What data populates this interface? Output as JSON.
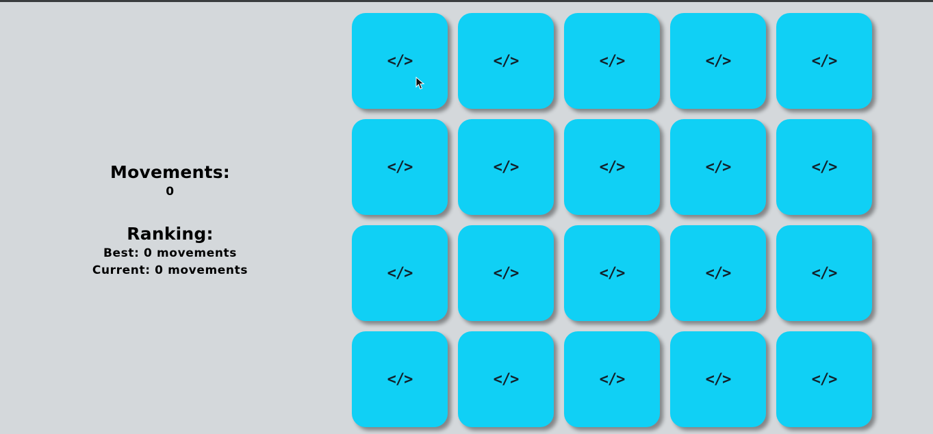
{
  "theme": {
    "background": "#d4d8db",
    "card_color": "#10d0f5",
    "icon_color": "#12202a"
  },
  "sidebar": {
    "movements_label": "Movements:",
    "movements_value": "0",
    "ranking_label": "Ranking:",
    "best_text": "Best: 0 movements",
    "current_text": "Current: 0 movements"
  },
  "board": {
    "rows": 4,
    "cols": 5,
    "card_state": "face-down",
    "card_icon": "code-icon",
    "card_glyph": "</>"
  }
}
